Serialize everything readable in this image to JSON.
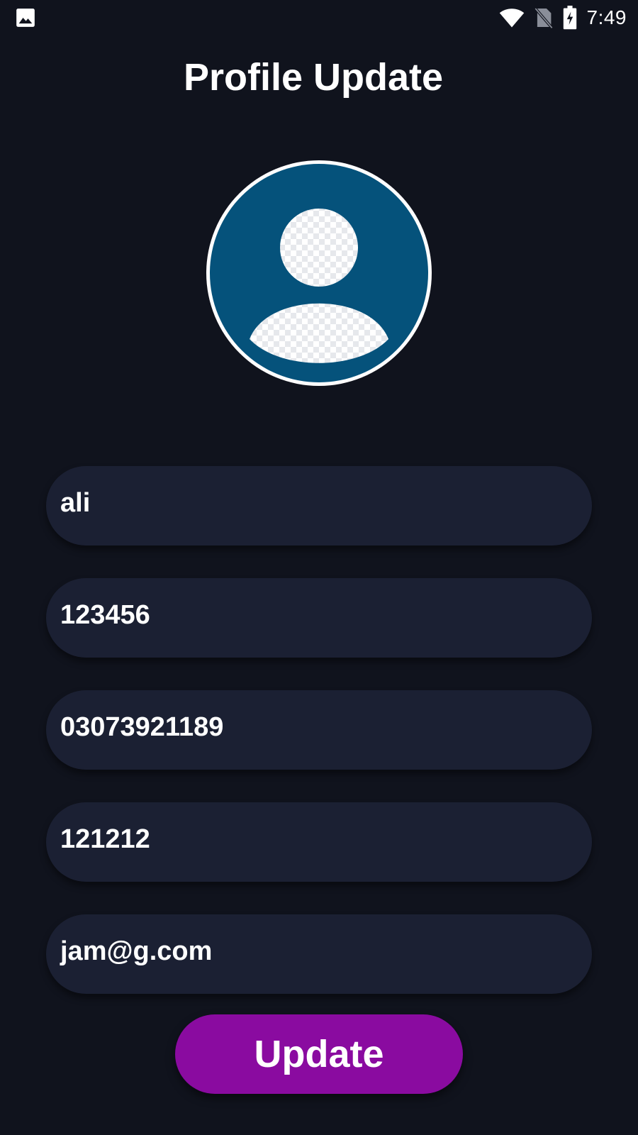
{
  "status_bar": {
    "time": "7:49",
    "left_icon": "image-icon",
    "icons": [
      "wifi-icon",
      "no-sim-icon",
      "battery-charging-icon"
    ]
  },
  "page": {
    "title": "Profile Update"
  },
  "avatar": {
    "icon": "default-user-avatar-icon",
    "colors": {
      "circle": "#05527b",
      "ring": "#ffffff"
    }
  },
  "form": {
    "fields": [
      {
        "value": "ali"
      },
      {
        "value": "123456"
      },
      {
        "value": "03073921189"
      },
      {
        "value": "121212"
      },
      {
        "value": "jam@g.com"
      }
    ],
    "submit_label": "Update"
  },
  "colors": {
    "background": "#10131d",
    "field_background": "#1b2033",
    "button": "#8a0ba0",
    "text": "#ffffff"
  }
}
